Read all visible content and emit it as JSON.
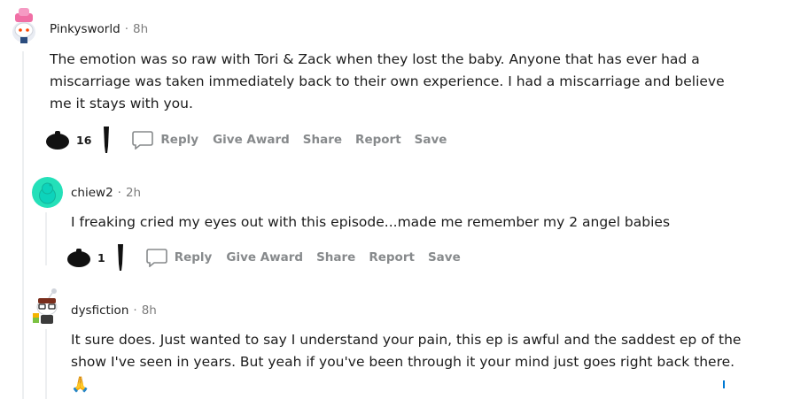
{
  "comments": [
    {
      "username": "Pinkysworld",
      "separator": "·",
      "time": "8h",
      "body": "The emotion was so raw with Tori & Zack when they lost the baby. Anyone that has ever had a miscarriage was taken immediately back to their own experience. I had a miscarriage and believe me it stays with you.",
      "score": "16",
      "avatar": "snoo-avatar-pink-hat-icon"
    },
    {
      "username": "chiew2",
      "separator": "·",
      "time": "2h",
      "body": "I freaking cried my eyes out with this episode...made me remember my 2 angel babies",
      "score": "1",
      "avatar": "snoo-avatar-teal-icon"
    },
    {
      "username": "dysfiction",
      "separator": "·",
      "time": "8h",
      "body": "It sure does. Just wanted to say I understand your pain, this ep is awful and the saddest ep of the show I've seen in years. But yeah if you've been through it your mind just goes right back there.",
      "emoji": "🙏",
      "avatar": "snoo-avatar-glasses-icon"
    }
  ],
  "actions": {
    "reply": "Reply",
    "give_award": "Give Award",
    "share": "Share",
    "report": "Report",
    "save": "Save"
  },
  "colors": {
    "action_gray": "#878a8c",
    "meta_gray": "#7c7c7c",
    "thread_line": "#edeff1",
    "teal_avatar": "#24e0b9"
  }
}
